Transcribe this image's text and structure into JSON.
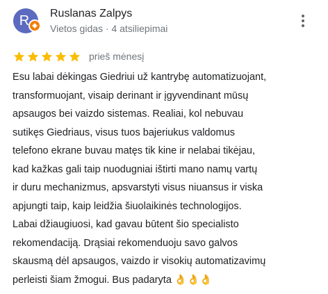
{
  "review": {
    "reviewer_name": "Ruslanas Zalpys",
    "reviewer_initial": "R",
    "reviewer_meta": "Vietos gidas · 4 atsiliepimai",
    "rating": 5,
    "max_rating": 5,
    "date": "prieš mėnesį",
    "text": "Esu labai dėkingas Giedriui už kantrybę automatizuojant,\ntransformuojant, visaip derinant ir įgyvendinant mūsų\napsaugos bei vaizdo sistemas.  Realiai, kol nebuvau\nsutikęs Giedriaus, visus tuos bajeriukus valdomus\ntelefono ekrane buvau matęs tik kine ir nelabai tikėjau,\nkad kažkas gali taip nuodugniai ištirti mano namų vartų\nir duru mechanizmus, apsvarstyti visus niuansus ir viska\napjungti taip, kaip leidžia šiuolaikinės technologijos.\nLabai džiaugiuosi, kad gavau būtent šio specialisto\nrekomendaciją. Drąsiai rekomenduoju savo galvos\nskausmą dėl apsaugos, vaizdo ir visokių automatizavimų\nperleisti šiam žmogui. Bus padaryta 👌👌👌"
  },
  "colors": {
    "avatar_bg": "#5c6bc0",
    "guide_badge": "#f57c00",
    "star": "#fbbc04",
    "meta_text": "#70757a",
    "body_text": "#202124"
  },
  "icons": {
    "more": "more-vertical-icon",
    "star": "star-icon",
    "guide_badge": "local-guide-badge-icon"
  }
}
